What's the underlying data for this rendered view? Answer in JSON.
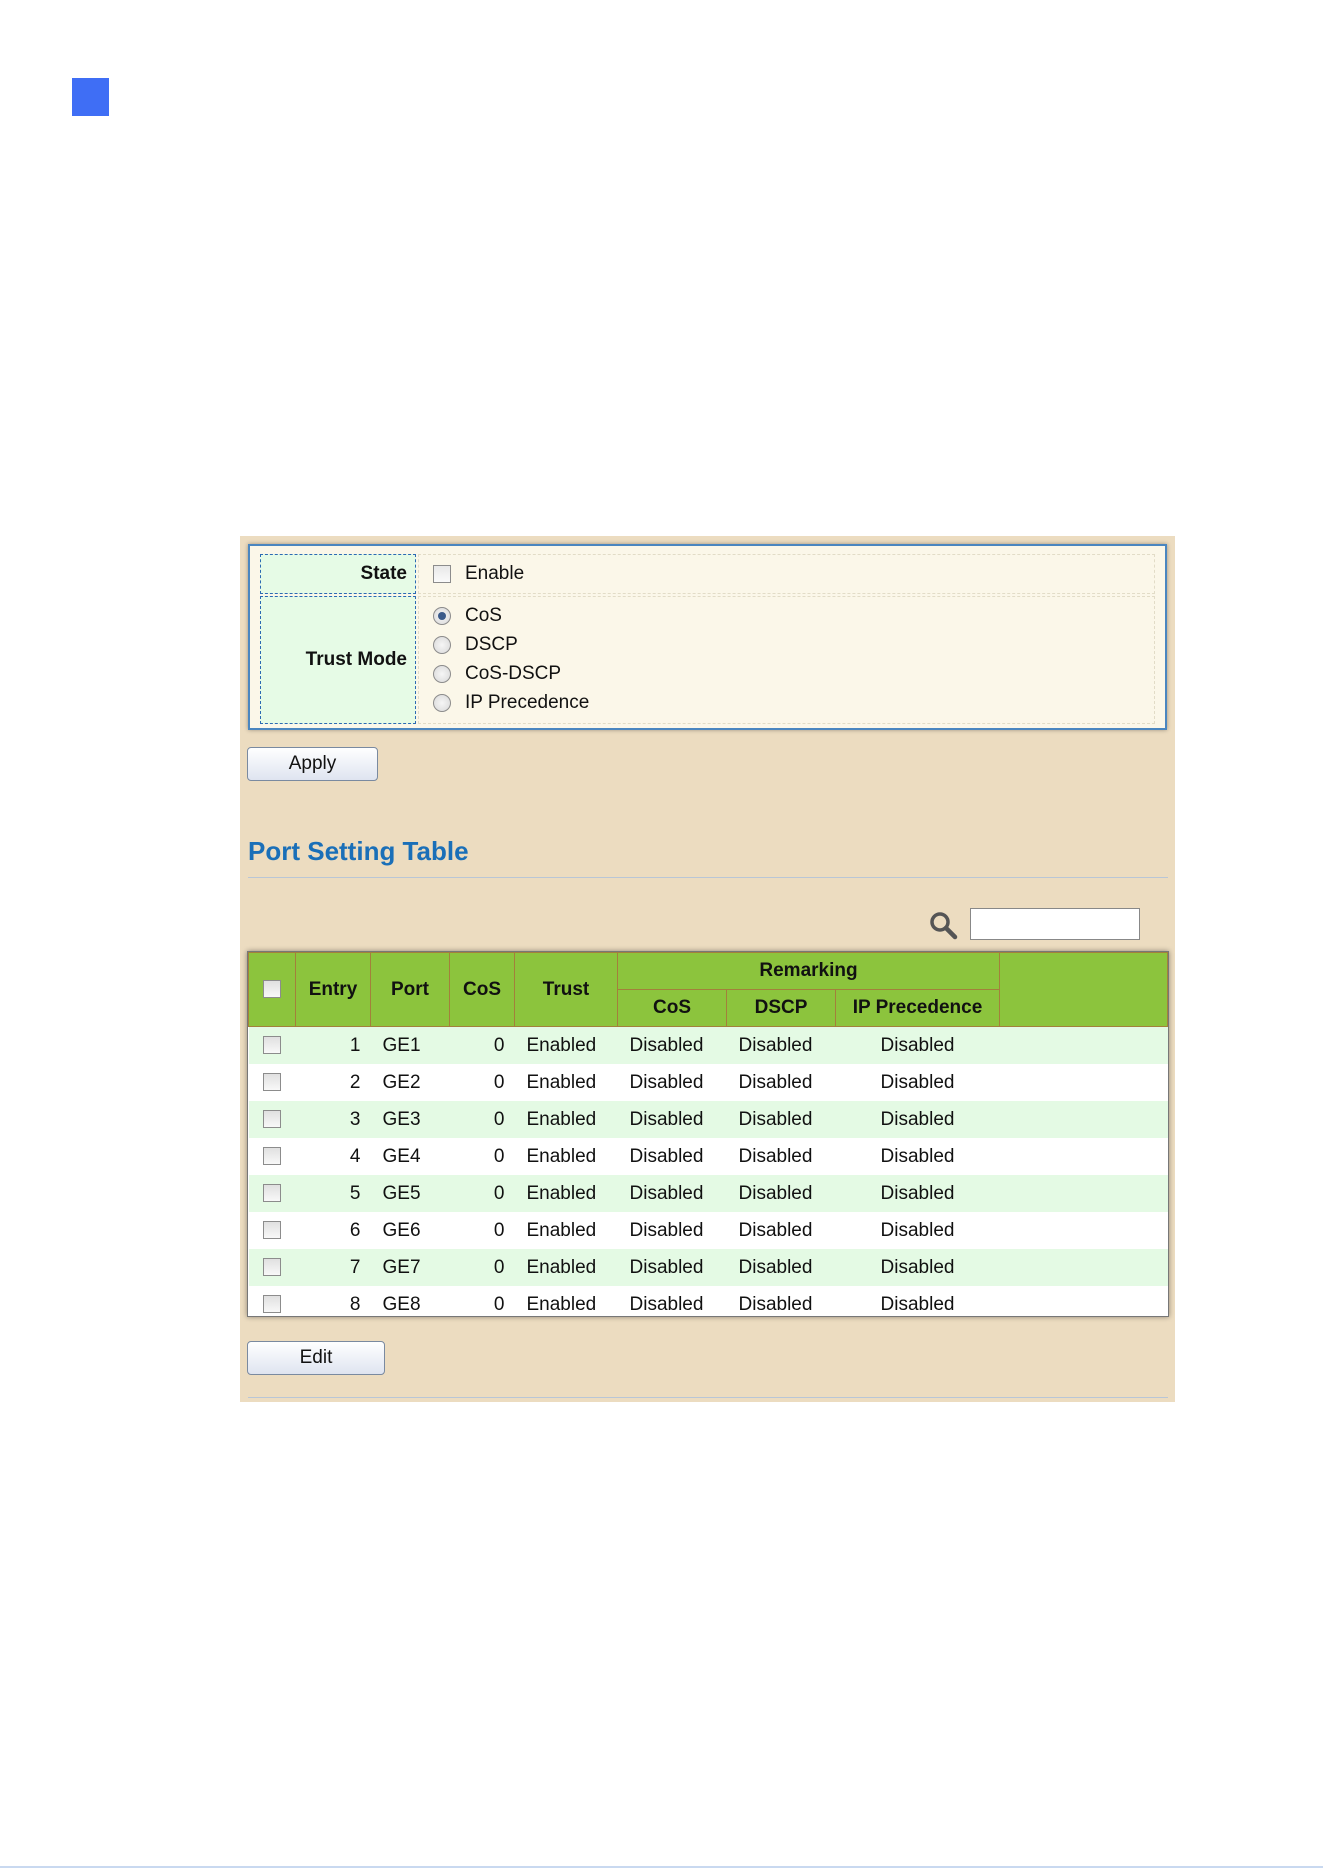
{
  "state": {
    "label": "State",
    "enable_label": "Enable"
  },
  "trust_mode": {
    "label": "Trust Mode",
    "options": [
      "CoS",
      "DSCP",
      "CoS-DSCP",
      "IP Precedence"
    ],
    "selected": "CoS"
  },
  "apply_label": "Apply",
  "port_table": {
    "title": "Port Setting Table",
    "headers": {
      "entry": "Entry",
      "port": "Port",
      "cos": "CoS",
      "trust": "Trust",
      "remarking": "Remarking",
      "remark_cos": "CoS",
      "remark_dscp": "DSCP",
      "remark_ip": "IP Precedence"
    },
    "rows": [
      {
        "entry": "1",
        "port": "GE1",
        "cos": "0",
        "trust": "Enabled",
        "remark_cos": "Disabled",
        "remark_dscp": "Disabled",
        "remark_ip": "Disabled"
      },
      {
        "entry": "2",
        "port": "GE2",
        "cos": "0",
        "trust": "Enabled",
        "remark_cos": "Disabled",
        "remark_dscp": "Disabled",
        "remark_ip": "Disabled"
      },
      {
        "entry": "3",
        "port": "GE3",
        "cos": "0",
        "trust": "Enabled",
        "remark_cos": "Disabled",
        "remark_dscp": "Disabled",
        "remark_ip": "Disabled"
      },
      {
        "entry": "4",
        "port": "GE4",
        "cos": "0",
        "trust": "Enabled",
        "remark_cos": "Disabled",
        "remark_dscp": "Disabled",
        "remark_ip": "Disabled"
      },
      {
        "entry": "5",
        "port": "GE5",
        "cos": "0",
        "trust": "Enabled",
        "remark_cos": "Disabled",
        "remark_dscp": "Disabled",
        "remark_ip": "Disabled"
      },
      {
        "entry": "6",
        "port": "GE6",
        "cos": "0",
        "trust": "Enabled",
        "remark_cos": "Disabled",
        "remark_dscp": "Disabled",
        "remark_ip": "Disabled"
      },
      {
        "entry": "7",
        "port": "GE7",
        "cos": "0",
        "trust": "Enabled",
        "remark_cos": "Disabled",
        "remark_dscp": "Disabled",
        "remark_ip": "Disabled"
      },
      {
        "entry": "8",
        "port": "GE8",
        "cos": "0",
        "trust": "Enabled",
        "remark_cos": "Disabled",
        "remark_dscp": "Disabled",
        "remark_ip": "Disabled"
      }
    ]
  },
  "edit_label": "Edit",
  "colors": {
    "accent_square": "#3f6ef5",
    "panel_bg": "#ecdcc0",
    "header_green": "#8cc43d",
    "row_alt": "#e4fae4",
    "title_blue": "#1a6fb8"
  }
}
